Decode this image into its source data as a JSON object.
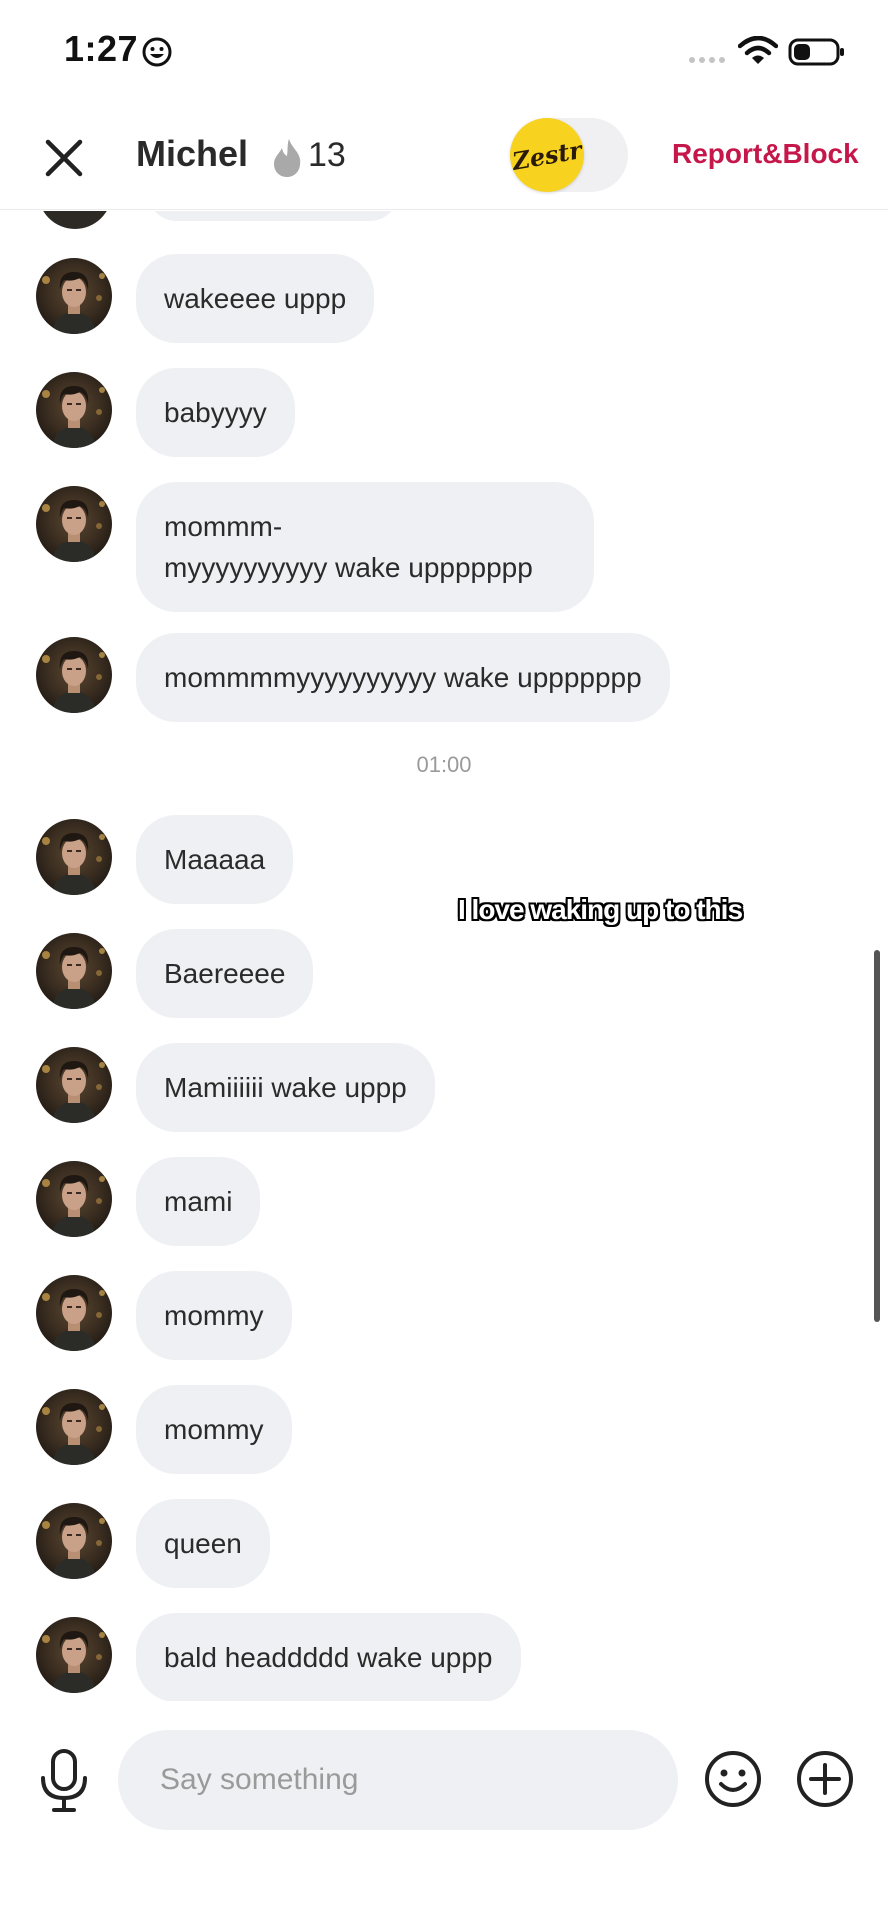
{
  "status_bar": {
    "time": "1:27",
    "icons": [
      "smiley-icon",
      "signal-dots-icon",
      "wifi-icon",
      "battery-icon"
    ]
  },
  "header": {
    "name": "Michel",
    "flame_count": "13",
    "zestr_logo": "Zestr",
    "report_label": "Report&Block"
  },
  "messages": [
    {
      "text": "wakeeee uppp"
    },
    {
      "text": "babyyyy"
    },
    {
      "text": "mommm-\nmyyyyyyyyyy wake uppppppp"
    },
    {
      "text": "mommmmyyyyyyyyyy wake uppppppp"
    },
    {
      "text": "Maaaaa"
    },
    {
      "text": "Baereeee"
    },
    {
      "text": "Mamiiiiii wake uppp"
    },
    {
      "text": "mami"
    },
    {
      "text": "mommy"
    },
    {
      "text": "mommy"
    },
    {
      "text": "queen"
    },
    {
      "text": "bald headdddd wake uppp"
    }
  ],
  "time_separator": "01:00",
  "overlay_caption": "I love waking up to this",
  "input": {
    "placeholder": "Say something"
  },
  "colors": {
    "accent": "#c5174a",
    "bubble": "#eef0f3",
    "zestr_yellow": "#f7d21f"
  }
}
